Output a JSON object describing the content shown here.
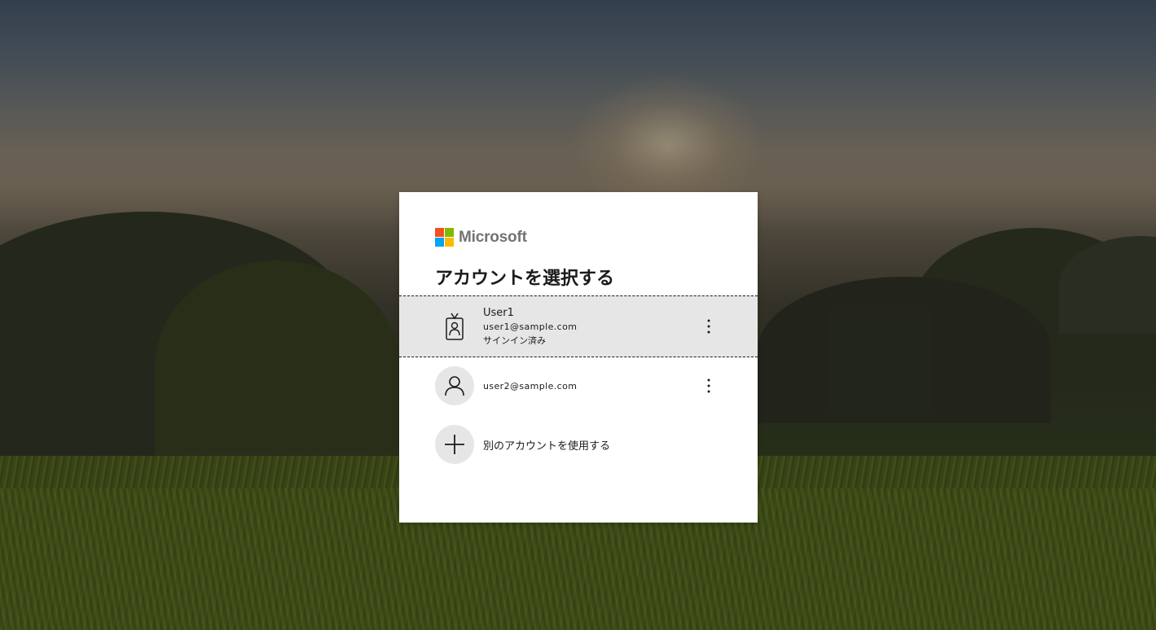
{
  "brand": {
    "name": "Microsoft",
    "colors": {
      "red": "#f25022",
      "green": "#7fba00",
      "blue": "#00a4ef",
      "yellow": "#ffb900"
    }
  },
  "page": {
    "title": "アカウントを選択する"
  },
  "accounts": [
    {
      "name": "User1",
      "email": "user1@sample.com",
      "status": "サインイン済み",
      "icon": "badge-icon",
      "selected": true
    },
    {
      "name": "",
      "email": "user2@sample.com",
      "status": "",
      "icon": "person-icon",
      "selected": false
    }
  ],
  "other_account": {
    "label": "別のアカウントを使用する",
    "icon": "plus-icon"
  },
  "more_icon": "more-vertical-icon",
  "colors": {
    "selected_bg": "#e6e6e6",
    "text": "#1b1b1b",
    "avatar_bg": "#e6e6e6"
  }
}
